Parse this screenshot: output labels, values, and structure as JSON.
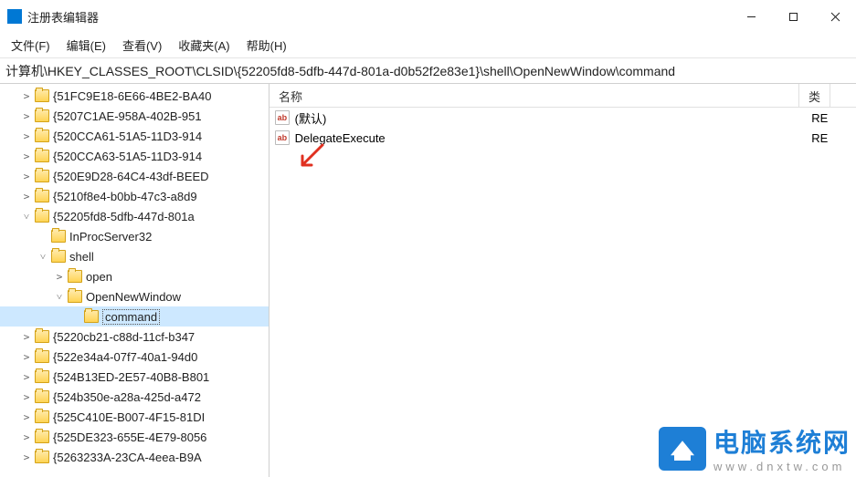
{
  "titlebar": {
    "title": "注册表编辑器"
  },
  "menubar": {
    "items": [
      {
        "label": "文件(F)"
      },
      {
        "label": "编辑(E)"
      },
      {
        "label": "查看(V)"
      },
      {
        "label": "收藏夹(A)"
      },
      {
        "label": "帮助(H)"
      }
    ]
  },
  "address": "计算机\\HKEY_CLASSES_ROOT\\CLSID\\{52205fd8-5dfb-447d-801a-d0b52f2e83e1}\\shell\\OpenNewWindow\\command",
  "tree": {
    "items": [
      {
        "depth": 1,
        "expand": ">",
        "label": "{51FC9E18-6E66-4BE2-BA40"
      },
      {
        "depth": 1,
        "expand": ">",
        "label": "{5207C1AE-958A-402B-951"
      },
      {
        "depth": 1,
        "expand": ">",
        "label": "{520CCA61-51A5-11D3-914"
      },
      {
        "depth": 1,
        "expand": ">",
        "label": "{520CCA63-51A5-11D3-914"
      },
      {
        "depth": 1,
        "expand": ">",
        "label": "{520E9D28-64C4-43df-BEED"
      },
      {
        "depth": 1,
        "expand": ">",
        "label": "{5210f8e4-b0bb-47c3-a8d9"
      },
      {
        "depth": 1,
        "expand": "v",
        "label": "{52205fd8-5dfb-447d-801a"
      },
      {
        "depth": 2,
        "expand": "",
        "label": "InProcServer32"
      },
      {
        "depth": 2,
        "expand": "v",
        "label": "shell"
      },
      {
        "depth": 3,
        "expand": ">",
        "label": "open"
      },
      {
        "depth": 3,
        "expand": "v",
        "label": "OpenNewWindow"
      },
      {
        "depth": 4,
        "expand": "",
        "label": "command",
        "selected": true
      },
      {
        "depth": 1,
        "expand": ">",
        "label": "{5220cb21-c88d-11cf-b347"
      },
      {
        "depth": 1,
        "expand": ">",
        "label": "{522e34a4-07f7-40a1-94d0"
      },
      {
        "depth": 1,
        "expand": ">",
        "label": "{524B13ED-2E57-40B8-B801"
      },
      {
        "depth": 1,
        "expand": ">",
        "label": "{524b350e-a28a-425d-a472"
      },
      {
        "depth": 1,
        "expand": ">",
        "label": "{525C410E-B007-4F15-81DI"
      },
      {
        "depth": 1,
        "expand": ">",
        "label": "{525DE323-655E-4E79-8056"
      },
      {
        "depth": 1,
        "expand": ">",
        "label": "{5263233A-23CA-4eea-B9A"
      }
    ]
  },
  "list": {
    "headers": {
      "name": "名称",
      "type": "类"
    },
    "rows": [
      {
        "icon": "ab",
        "name": "(默认)",
        "type": "RE"
      },
      {
        "icon": "ab",
        "name": "DelegateExecute",
        "type": "RE"
      }
    ]
  },
  "watermark": {
    "title": "电脑系统网",
    "url": "www.dnxtw.com"
  }
}
